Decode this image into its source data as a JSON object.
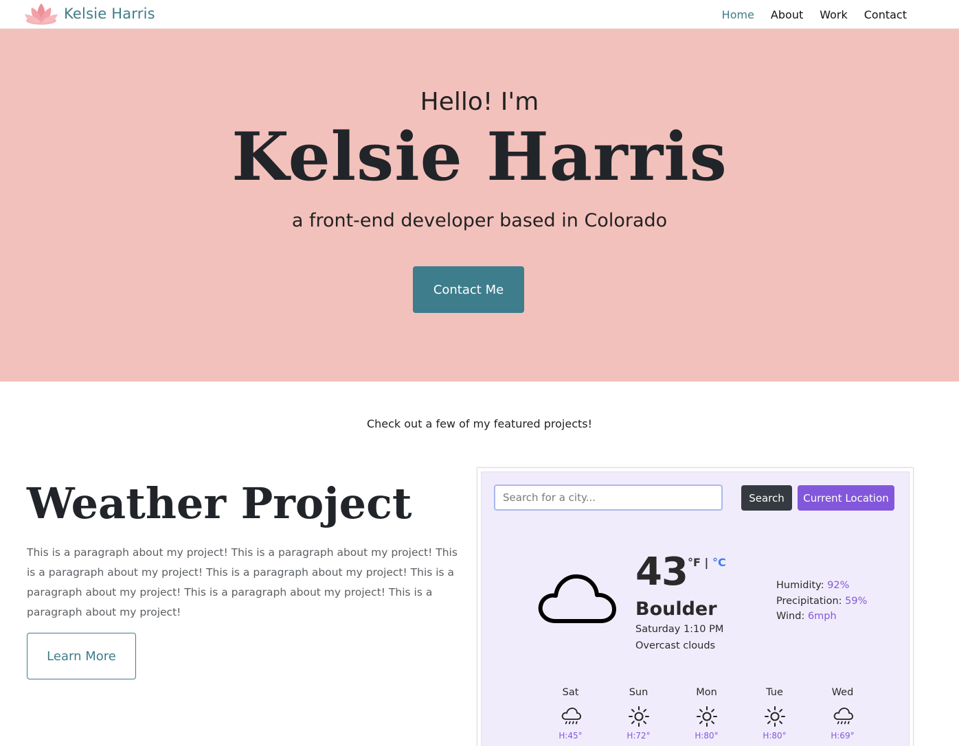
{
  "nav": {
    "brand_name": "Kelsie Harris",
    "links": [
      "Home",
      "About",
      "Work",
      "Contact"
    ],
    "active_link": "Home"
  },
  "hero": {
    "greeting": "Hello! I'm",
    "name": "Kelsie Harris",
    "tagline": "a front-end developer based in Colorado",
    "cta_label": "Contact Me",
    "background_color": "#f3c1bc",
    "button_color": "#3e7d8b"
  },
  "featured": {
    "intro": "Check out a few of my featured projects!"
  },
  "project": {
    "title": "Weather Project",
    "description": "This is a paragraph about my project! This is a paragraph about my project! This is a paragraph about my project! This is a paragraph about my project! This is a paragraph about my project! This is a paragraph about my project! This is a paragraph about my project!",
    "button_label": "Learn More"
  },
  "weather": {
    "search_placeholder": "Search for a city...",
    "search_label": "Search",
    "location_label": "Current Location",
    "current_icon": "cloud-icon",
    "temperature": "43",
    "unit_f": "°F",
    "unit_sep": "|",
    "unit_c": "°C",
    "city": "Boulder",
    "datetime": "Saturday 1:10 PM",
    "description": "Overcast clouds",
    "humidity_label": "Humidity:",
    "humidity": "92%",
    "precipitation_label": "Precipitation:",
    "precipitation": "59%",
    "wind_label": "Wind:",
    "wind": "6mph",
    "accent_color": "#8357db",
    "forecast": [
      {
        "day": "Sat",
        "icon": "rain-icon",
        "high": "H:45°"
      },
      {
        "day": "Sun",
        "icon": "sun-icon",
        "high": "H:72°"
      },
      {
        "day": "Mon",
        "icon": "sun-icon",
        "high": "H:80°"
      },
      {
        "day": "Tue",
        "icon": "sun-icon",
        "high": "H:80°"
      },
      {
        "day": "Wed",
        "icon": "rain-icon",
        "high": "H:69°"
      }
    ]
  }
}
